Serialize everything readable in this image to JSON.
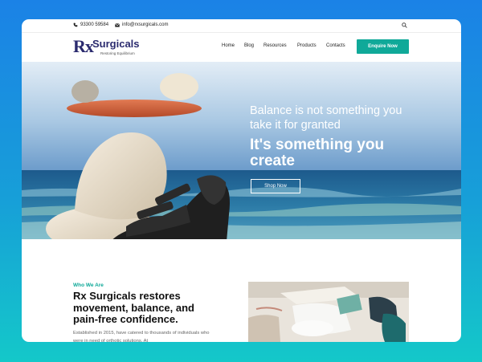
{
  "topbar": {
    "phone": "93300 59584",
    "email": "info@rxsurgicals.com"
  },
  "header": {
    "logo_rx": "Rx",
    "logo_name": "Surgicals",
    "logo_tagline": "Restoring Equilibrium",
    "nav": [
      "Home",
      "Blog",
      "Resources",
      "Products",
      "Contacts"
    ],
    "cta_label": "Enquire Now"
  },
  "hero": {
    "subtitle": "Balance is not something you take it for granted",
    "title": "It's something you create",
    "button_label": "Shop Now"
  },
  "about": {
    "eyebrow": "Who We Are",
    "heading": "Rx Surgicals restores movement, balance, and pain-free confidence.",
    "body": "Established in 2015, have catered to thousands of individuals who were in need of orthotic solutions. At"
  },
  "colors": {
    "accent": "#10a999",
    "brand": "#2a2a6e",
    "background_top": "#1b82e6",
    "background_bottom": "#14c8c9"
  },
  "icons": {
    "phone": "phone-icon",
    "email": "mail-icon",
    "search": "search-icon"
  }
}
